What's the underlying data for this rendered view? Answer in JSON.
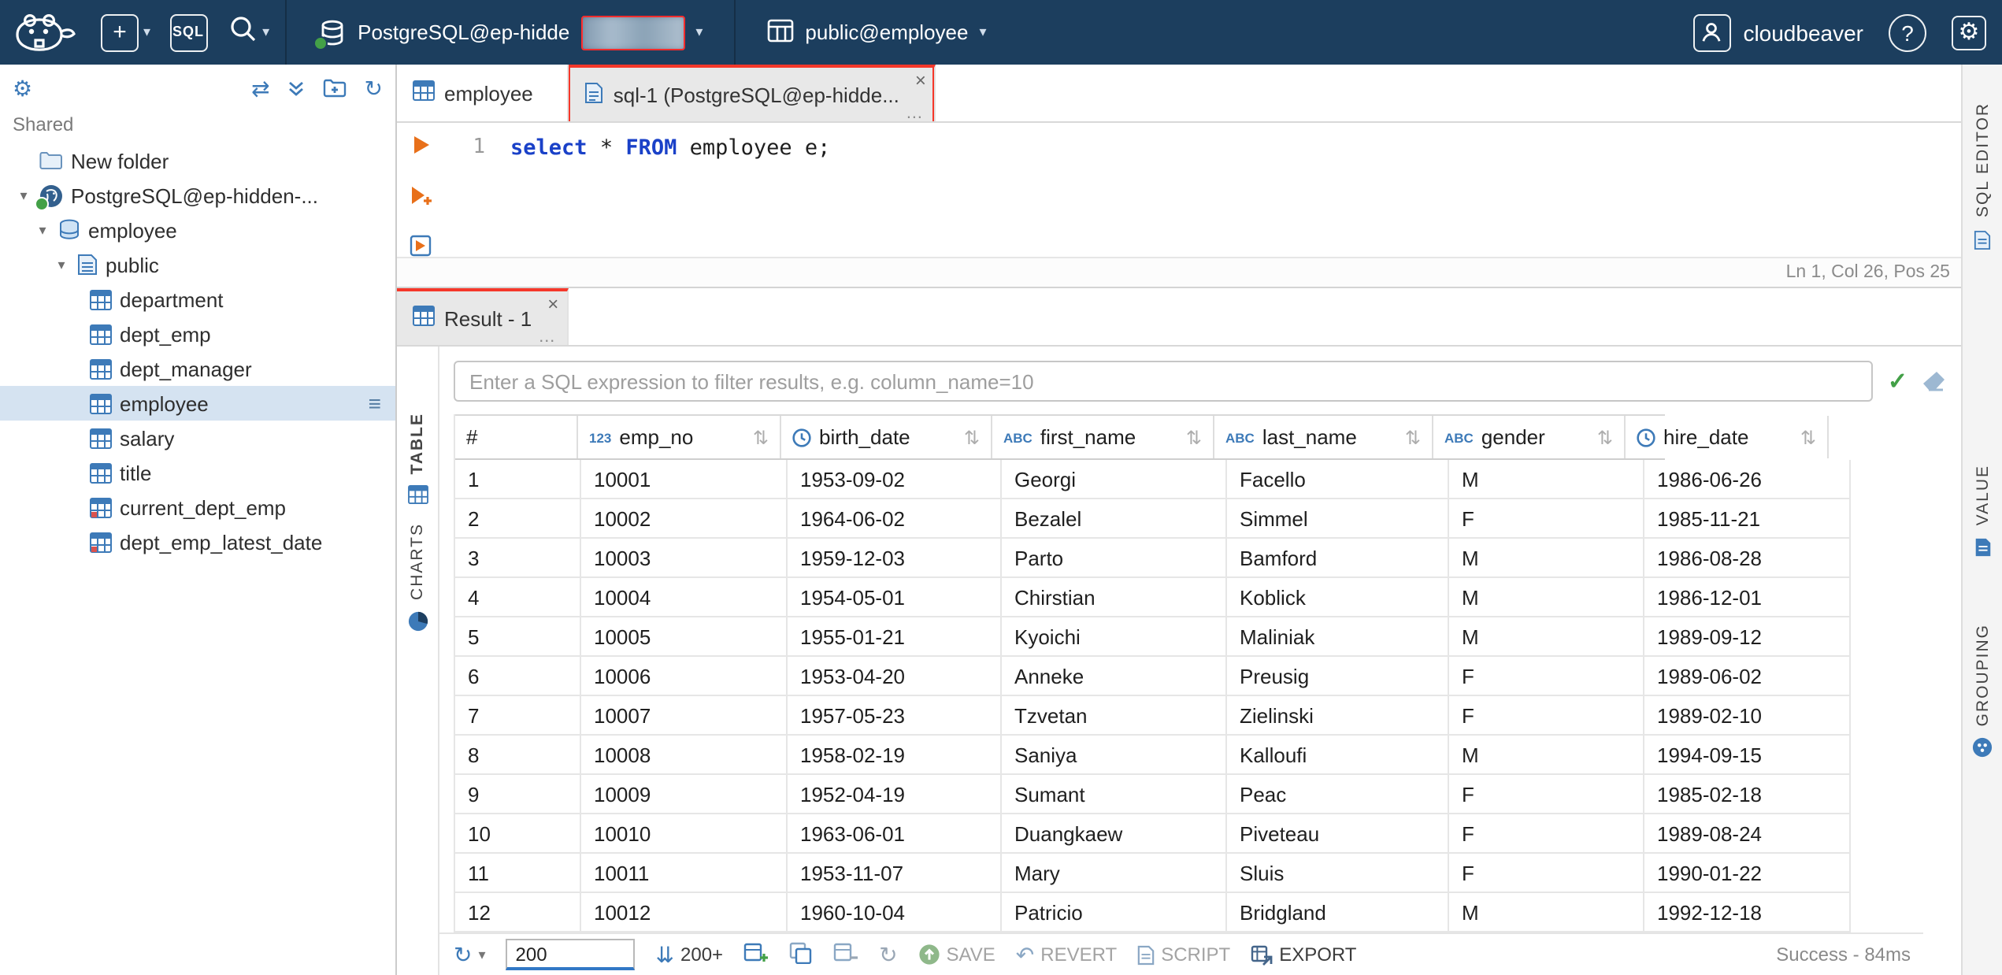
{
  "icons": {
    "chevron_down": "▾",
    "sort": "⇅",
    "close": "×",
    "more": "…",
    "menu": "≡",
    "gear": "⚙",
    "sync": "⇄",
    "refresh": "↻",
    "check": "✓",
    "question": "?",
    "plus": "+",
    "fetch": "⇊",
    "revert_arrow": "↶"
  },
  "topbar": {
    "sql_box_label": "SQL",
    "connection_label": "PostgreSQL@ep-hidde",
    "schema_label": "public@employee",
    "user_label": "cloudbeaver"
  },
  "sidebar": {
    "section_label": "Shared",
    "items": [
      {
        "label": "New folder",
        "type": "folder"
      },
      {
        "label": "PostgreSQL@ep-hidden-...",
        "type": "postgres"
      },
      {
        "label": "employee",
        "type": "database"
      },
      {
        "label": "public",
        "type": "schema"
      },
      {
        "label": "department",
        "type": "table"
      },
      {
        "label": "dept_emp",
        "type": "table"
      },
      {
        "label": "dept_manager",
        "type": "table"
      },
      {
        "label": "employee",
        "type": "table",
        "selected": true
      },
      {
        "label": "salary",
        "type": "table"
      },
      {
        "label": "title",
        "type": "table"
      },
      {
        "label": "current_dept_emp",
        "type": "view"
      },
      {
        "label": "dept_emp_latest_date",
        "type": "view"
      }
    ]
  },
  "editor": {
    "tab_employee": "employee",
    "tab_sql": "sql-1 (PostgreSQL@ep-hidde...",
    "line_number": "1",
    "code": {
      "kw1": "select",
      "mid": " * ",
      "kw2": "FROM",
      "rest": " employee e;"
    },
    "status": "Ln 1, Col 26, Pos 25",
    "side_tab": "SQL EDITOR"
  },
  "result": {
    "tab_label": "Result - 1",
    "filter_placeholder": "Enter a SQL expression to filter results, e.g. column_name=10",
    "left_tabs": {
      "table": "TABLE",
      "charts": "CHARTS"
    },
    "right_tabs": {
      "value": "VALUE",
      "grouping": "GROUPING"
    },
    "grid": {
      "row_number_header": "#",
      "columns": [
        {
          "name": "emp_no",
          "type_label": "123"
        },
        {
          "name": "birth_date",
          "type": "date"
        },
        {
          "name": "first_name",
          "type_label": "ABC"
        },
        {
          "name": "last_name",
          "type_label": "ABC"
        },
        {
          "name": "gender",
          "type_label": "ABC"
        },
        {
          "name": "hire_date",
          "type": "date"
        }
      ],
      "rows": [
        [
          "1",
          "10001",
          "1953-09-02",
          "Georgi",
          "Facello",
          "M",
          "1986-06-26"
        ],
        [
          "2",
          "10002",
          "1964-06-02",
          "Bezalel",
          "Simmel",
          "F",
          "1985-11-21"
        ],
        [
          "3",
          "10003",
          "1959-12-03",
          "Parto",
          "Bamford",
          "M",
          "1986-08-28"
        ],
        [
          "4",
          "10004",
          "1954-05-01",
          "Chirstian",
          "Koblick",
          "M",
          "1986-12-01"
        ],
        [
          "5",
          "10005",
          "1955-01-21",
          "Kyoichi",
          "Maliniak",
          "M",
          "1989-09-12"
        ],
        [
          "6",
          "10006",
          "1953-04-20",
          "Anneke",
          "Preusig",
          "F",
          "1989-06-02"
        ],
        [
          "7",
          "10007",
          "1957-05-23",
          "Tzvetan",
          "Zielinski",
          "F",
          "1989-02-10"
        ],
        [
          "8",
          "10008",
          "1958-02-19",
          "Saniya",
          "Kalloufi",
          "M",
          "1994-09-15"
        ],
        [
          "9",
          "10009",
          "1952-04-19",
          "Sumant",
          "Peac",
          "F",
          "1985-02-18"
        ],
        [
          "10",
          "10010",
          "1963-06-01",
          "Duangkaew",
          "Piveteau",
          "F",
          "1989-08-24"
        ],
        [
          "11",
          "10011",
          "1953-11-07",
          "Mary",
          "Sluis",
          "F",
          "1990-01-22"
        ],
        [
          "12",
          "10012",
          "1960-10-04",
          "Patricio",
          "Bridgland",
          "M",
          "1992-12-18"
        ]
      ]
    },
    "toolbar": {
      "row_limit_value": "200",
      "fetch_label": "200+",
      "save_label": "SAVE",
      "revert_label": "REVERT",
      "script_label": "SCRIPT",
      "export_label": "EXPORT",
      "status": "Success - 84ms"
    }
  }
}
